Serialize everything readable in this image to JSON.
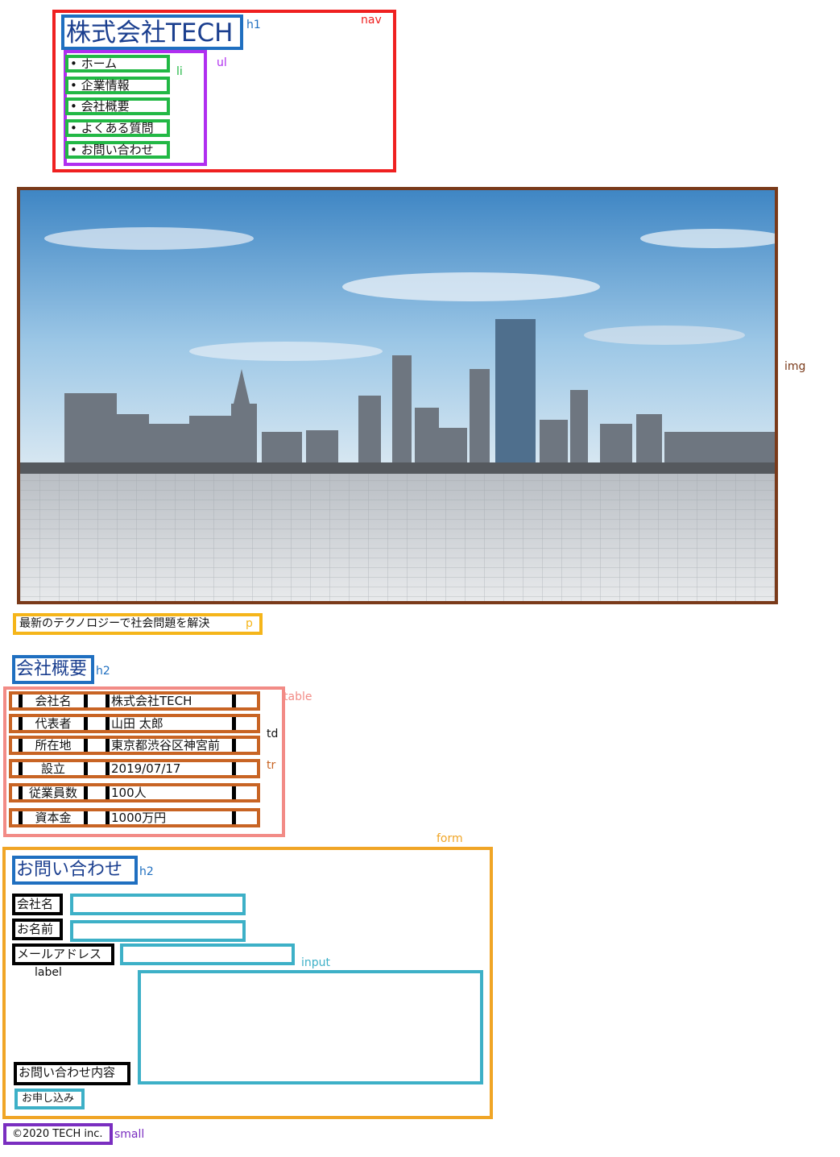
{
  "nav": {
    "title": "株式会社TECH",
    "items": [
      "ホーム",
      "企業情報",
      "会社概要",
      "よくある質問",
      "お問い合わせ"
    ]
  },
  "tagline": "最新のテクノロジーで社会問題を解決",
  "about": {
    "heading": "会社概要",
    "rows": [
      {
        "label": "会社名",
        "value": "株式会社TECH"
      },
      {
        "label": "代表者",
        "value": "山田 太郎"
      },
      {
        "label": "所在地",
        "value": "東京都渋谷区神宮前"
      },
      {
        "label": "設立",
        "value": "2019/07/17"
      },
      {
        "label": "従業員数",
        "value": "100人"
      },
      {
        "label": "資本金",
        "value": "1000万円"
      }
    ]
  },
  "contact": {
    "heading": "お問い合わせ",
    "fields": {
      "company": "会社名",
      "name": "お名前",
      "email": "メールアドレス",
      "message": "お問い合わせ内容"
    },
    "submit_label": "お申し込み"
  },
  "footer": {
    "copyright": "©2020 TECH inc."
  },
  "annotations": {
    "nav": "nav",
    "h1": "h1",
    "ul": "ul",
    "li": "li",
    "img": "img",
    "p": "p",
    "h2_about": "h2",
    "table": "table",
    "td": "td",
    "tr": "tr",
    "form": "form",
    "h2_contact": "h2",
    "input": "input",
    "label": "label",
    "small": "small"
  },
  "colors": {
    "nav": "#ef2020",
    "heading": "#1f6fc0",
    "ul": "#b02ef0",
    "li": "#22b845",
    "img": "#7a3a1a",
    "p": "#f5b51a",
    "table": "#f28b86",
    "tr": "#c86424",
    "form": "#f0a526",
    "input": "#3db0c7",
    "label": "#000000",
    "small": "#7a2ec0"
  }
}
